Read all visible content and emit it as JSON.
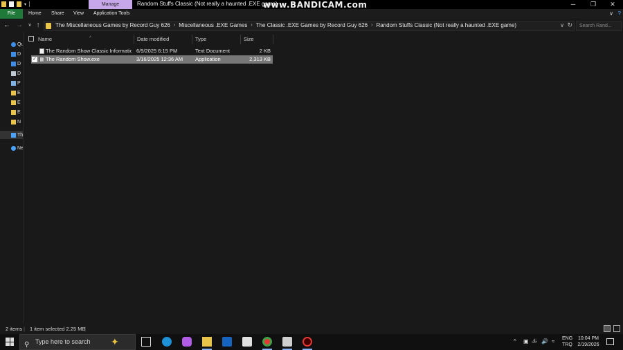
{
  "titlebar": {
    "manage_label": "Manage",
    "window_title": "Random Stuffs Classic (Not really a haunted .EXE game)",
    "watermark": "www.BANDICAM.com",
    "minimize": "─",
    "maximize": "❐",
    "close": "✕"
  },
  "ribbon": {
    "tabs": [
      "File",
      "Home",
      "Share",
      "View",
      "Application Tools"
    ],
    "expand": "∨",
    "help": "?"
  },
  "nav": {
    "back": "←",
    "forward": "→",
    "recent": "∨",
    "up": "↑"
  },
  "address": {
    "crumbs": [
      "The Miscellaneous Games by Record Guy 626",
      "Miscellaneous .EXE Games",
      "The Classic .EXE Games by Record Guy 626",
      "Random Stuffs Classic (Not really a haunted .EXE game)"
    ],
    "separator": "›",
    "dropdown": "∨",
    "refresh": "↻",
    "search_placeholder": "Search Rand..."
  },
  "navpane": {
    "items": [
      "Qu",
      "D",
      "D",
      "D",
      "P",
      "E",
      "E",
      "E",
      "N",
      "Th",
      "Ne"
    ]
  },
  "columns": {
    "name": "Name",
    "date": "Date modified",
    "type": "Type",
    "size": "Size",
    "sort_indicator": "˄"
  },
  "files": [
    {
      "name": "The Random Show Classic Information...",
      "date": "6/9/2025 6:15 PM",
      "type": "Text Document",
      "size": "2 KB",
      "selected": false,
      "icon": "text-document-icon"
    },
    {
      "name": "The Random Show.exe",
      "date": "3/16/2025 12:36 AM",
      "type": "Application",
      "size": "2,313 KB",
      "selected": true,
      "icon": "application-icon"
    }
  ],
  "status": {
    "items_count": "2 items",
    "selected": "1 item selected  2.25 MB"
  },
  "taskbar": {
    "search_text": "Type here to search",
    "lang_line1": "ENG",
    "lang_line2": "TRQ",
    "time": "10:04 PM",
    "date": "2/19/2026"
  },
  "colors": {
    "accent_green": "#1f7a3a",
    "manage_tab": "#c8a6ea",
    "selection": "#777777",
    "folder_yellow": "#e8c44b"
  }
}
